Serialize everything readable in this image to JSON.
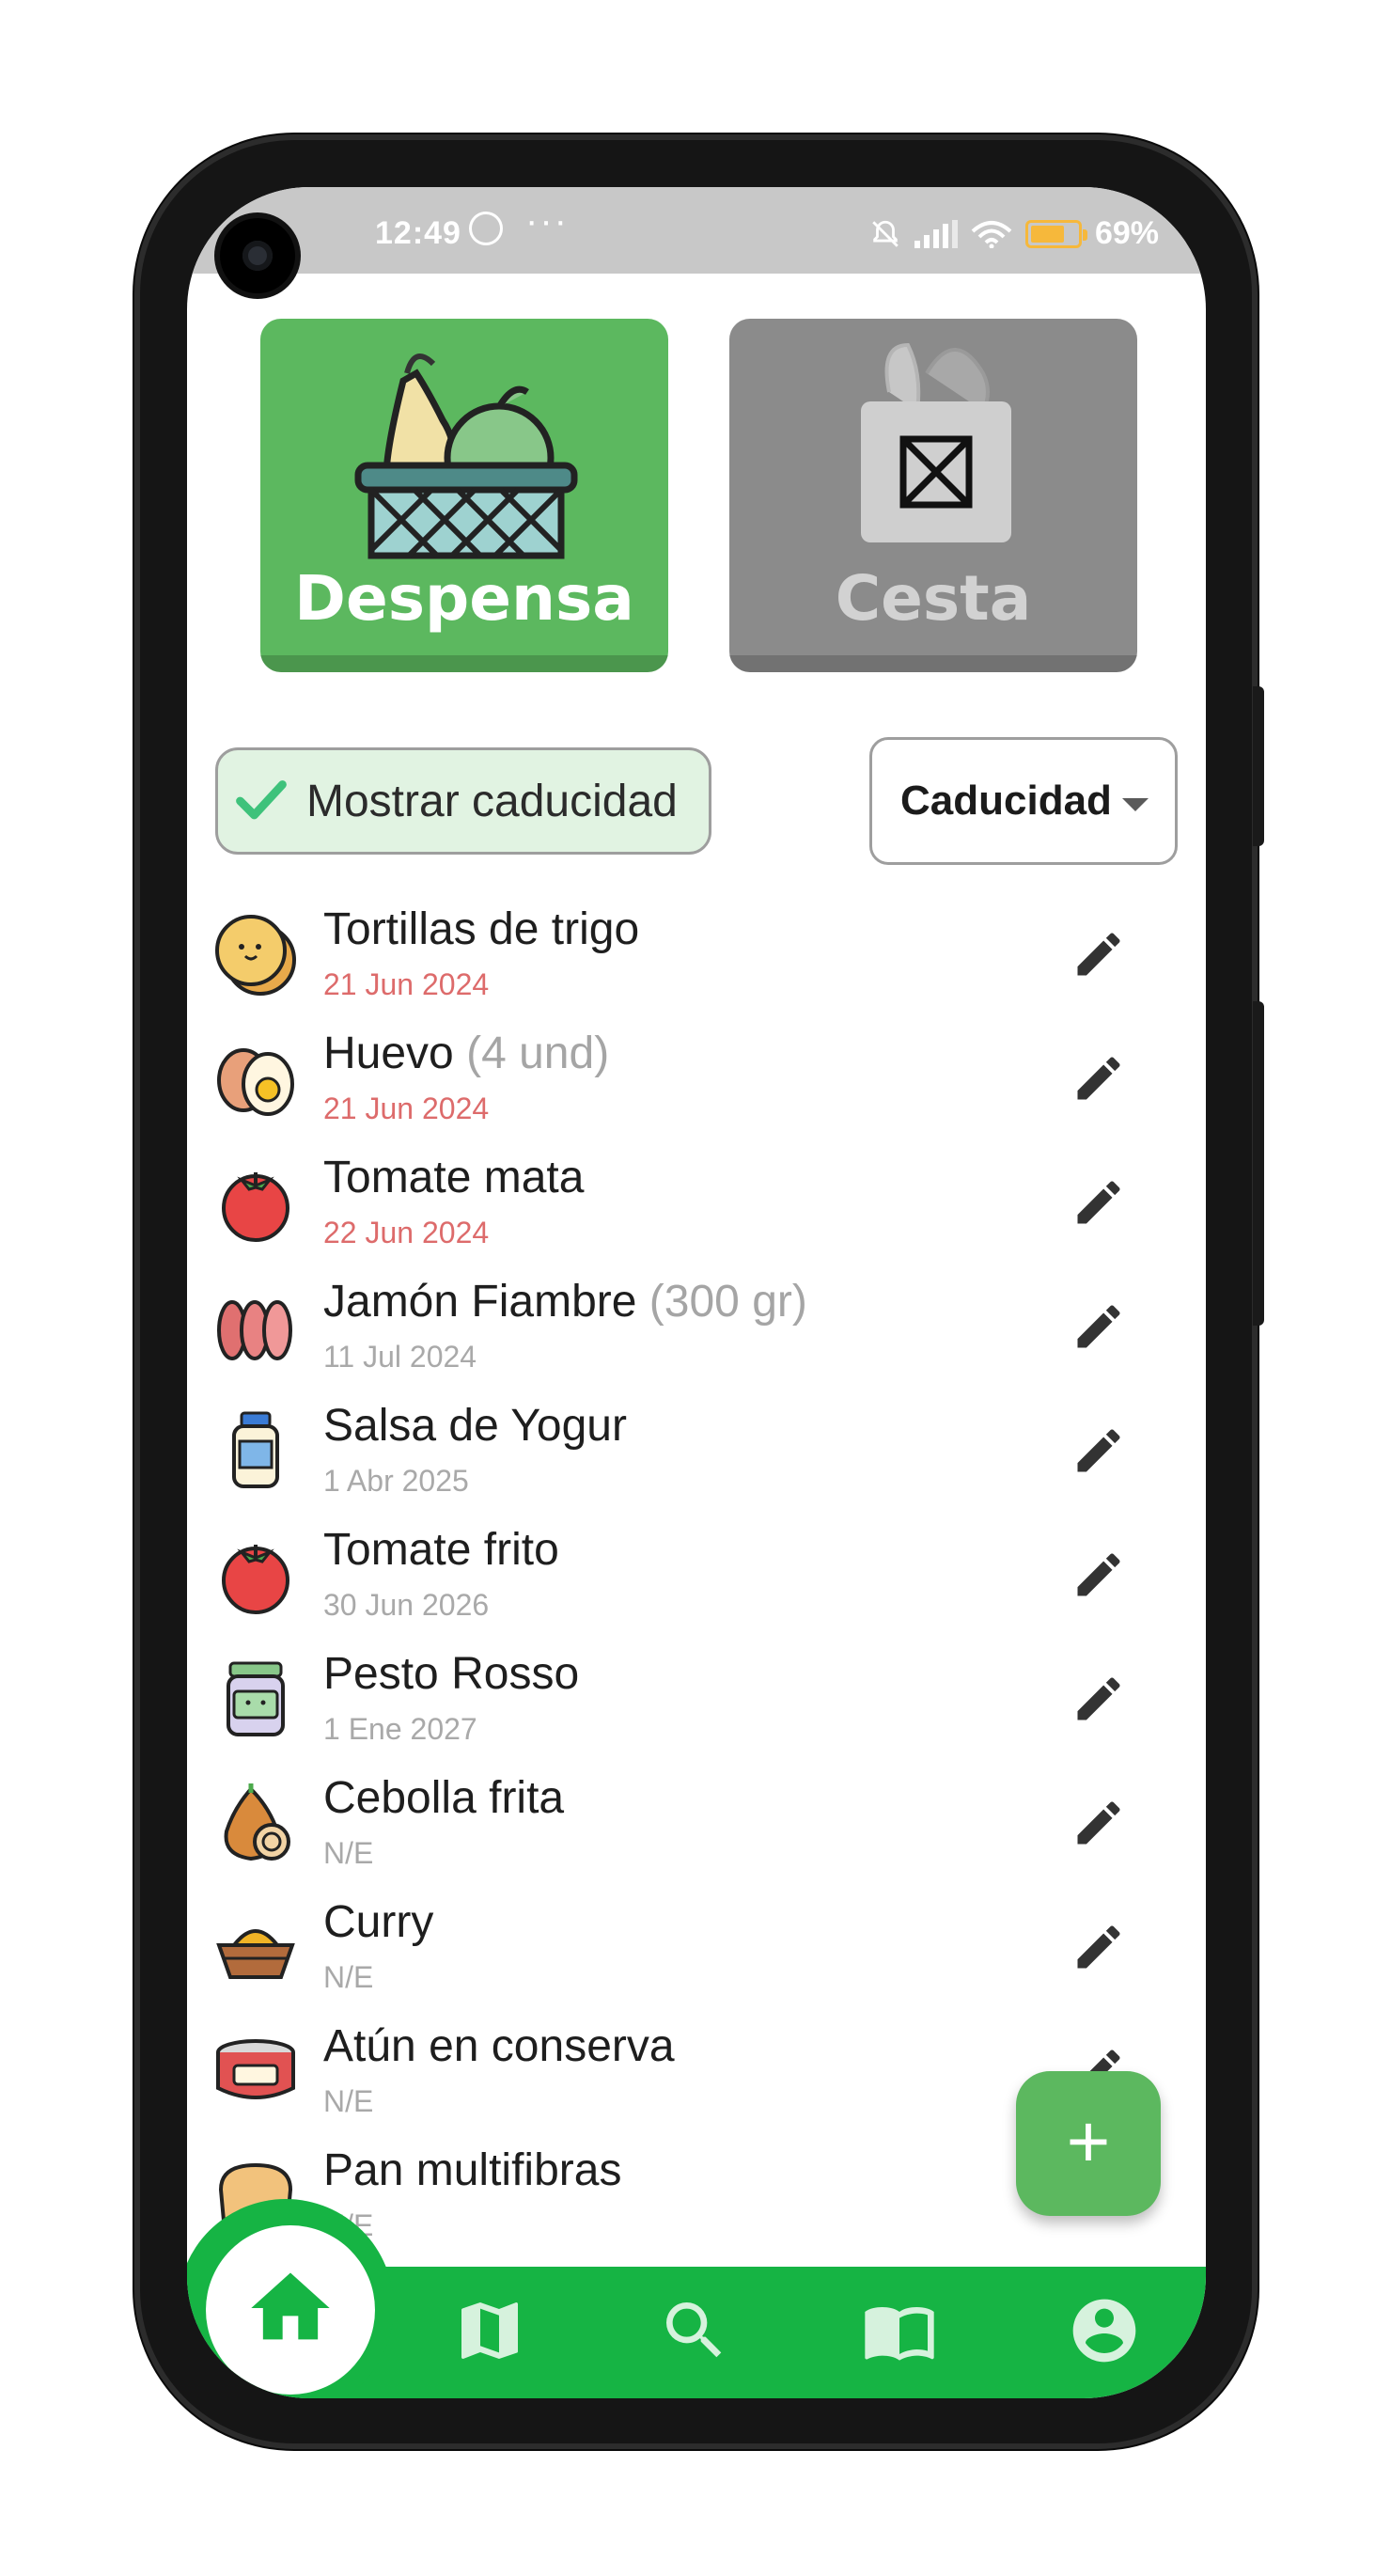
{
  "status_bar": {
    "time": "12:49",
    "more": "···",
    "battery": "69%"
  },
  "cards": {
    "despensa": "Despensa",
    "cesta": "Cesta"
  },
  "filter": {
    "show_expiry_label": "Mostrar caducidad",
    "sort_value": "Caducidad"
  },
  "items": [
    {
      "name": "Tortillas de trigo",
      "qty": "",
      "date": "21 Jun 2024",
      "expired": true,
      "icon": "tortilla-icon"
    },
    {
      "name": "Huevo",
      "qty": "(4 und)",
      "date": "21 Jun 2024",
      "expired": true,
      "icon": "egg-icon"
    },
    {
      "name": "Tomate mata",
      "qty": "",
      "date": "22 Jun 2024",
      "expired": true,
      "icon": "tomato-icon"
    },
    {
      "name": "Jamón Fiambre",
      "qty": "(300 gr)",
      "date": "11 Jul 2024",
      "expired": false,
      "icon": "ham-icon"
    },
    {
      "name": "Salsa de Yogur",
      "qty": "",
      "date": "1 Abr 2025",
      "expired": false,
      "icon": "jar-icon"
    },
    {
      "name": "Tomate frito",
      "qty": "",
      "date": "30 Jun 2026",
      "expired": false,
      "icon": "tomato-icon"
    },
    {
      "name": "Pesto Rosso",
      "qty": "",
      "date": "1 Ene 2027",
      "expired": false,
      "icon": "pesto-jar-icon"
    },
    {
      "name": "Cebolla frita",
      "qty": "",
      "date": "N/E",
      "expired": false,
      "icon": "onion-icon"
    },
    {
      "name": "Curry",
      "qty": "",
      "date": "N/E",
      "expired": false,
      "icon": "curry-bowl-icon"
    },
    {
      "name": "Atún en conserva",
      "qty": "",
      "date": "N/E",
      "expired": false,
      "icon": "tuna-can-icon"
    },
    {
      "name": "Pan multifibras",
      "qty": "",
      "date": "N/E",
      "expired": false,
      "icon": "bread-icon"
    }
  ],
  "fab_label": "+",
  "colors": {
    "primary": "#5cb85f",
    "nav": "#16b444",
    "expired": "#dd6b6b",
    "muted": "#a9a9a9"
  },
  "nav": [
    "home-icon",
    "map-icon",
    "search-icon",
    "recipe-book-icon",
    "account-icon"
  ]
}
